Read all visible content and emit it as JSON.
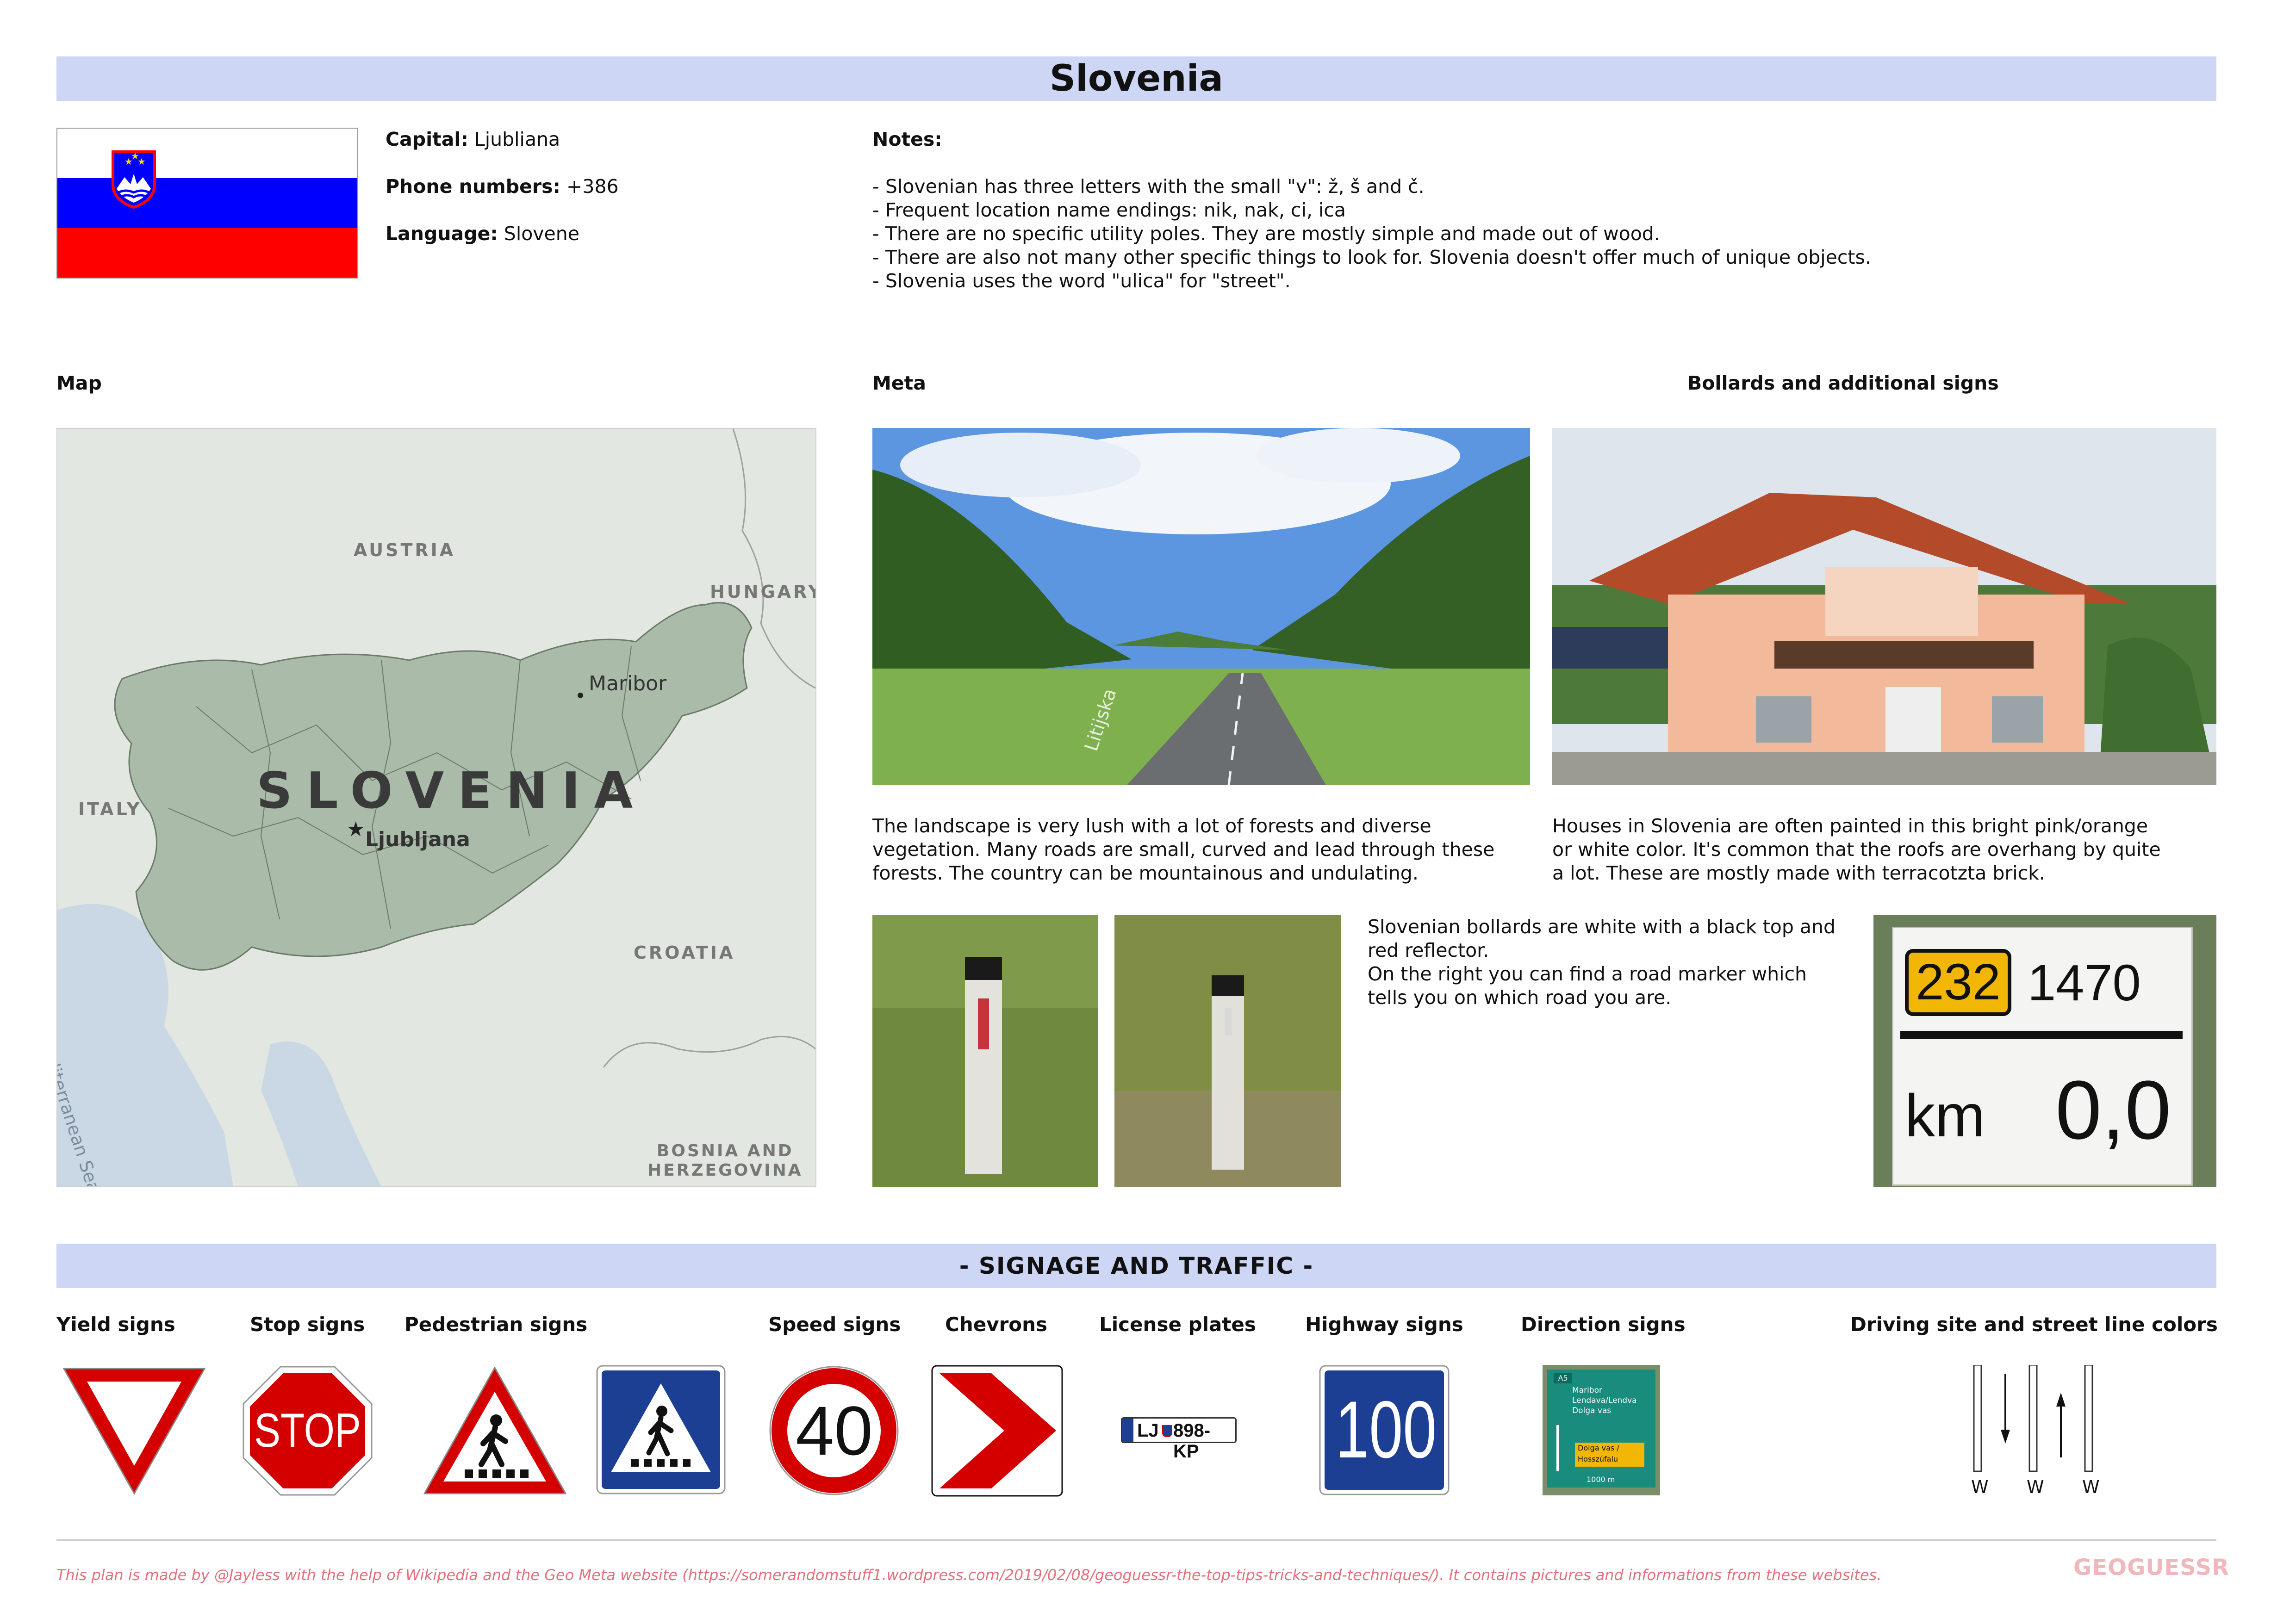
{
  "title": "Slovenia",
  "info": {
    "capital_label": "Capital:",
    "capital_value": "Ljubliana",
    "phone_label": "Phone numbers:",
    "phone_value": "+386",
    "language_label": "Language:",
    "language_value": "Slovene"
  },
  "notes": {
    "label": "Notes:",
    "lines": [
      "- Slovenian has three letters with the small \"v\": ž, š and č.",
      "- Frequent location name endings: nik, nak, ci, ica",
      "- There are no specific utility poles. They are mostly simple and made out of wood.",
      "- There are also not many other specific things to look for. Slovenia doesn't offer much of unique objects.",
      "- Slovenia uses the word \"ulica\" for \"street\"."
    ]
  },
  "sections": {
    "map": "Map",
    "meta": "Meta",
    "bollards": "Bollards and additional signs"
  },
  "map": {
    "country": "SLOVENIA",
    "capital": "Ljubljana",
    "city": "Maribor",
    "neighbors": [
      "AUSTRIA",
      "HUNGARY",
      "ITALY",
      "CROATIA",
      "BOSNIA AND",
      "HERZEGOVINA"
    ],
    "sea": "Mediterranean Sea"
  },
  "meta_text": [
    "The landscape is very lush with a lot of forests and diverse",
    "vegetation. Many roads are small, curved and lead through these",
    "forests. The country can be mountainous and undulating."
  ],
  "houses_text": [
    "Houses in Slovenia are often painted in this bright pink/orange",
    "or white color. It's common that the roofs are overhang by quite",
    "a lot. These are mostly made with terracotzta brick."
  ],
  "bollard_text": [
    "Slovenian bollards are white with a black top and",
    "red reflector.",
    "On the right you can find a road marker which",
    "tells you on which road you are."
  ],
  "road_marker": {
    "road": "232",
    "number": "1470",
    "km_label": "km",
    "km_value": "0,0"
  },
  "street_sign": "Litijska",
  "signage_banner": "- SIGNAGE AND TRAFFIC -",
  "sign_labels": {
    "yield": "Yield signs",
    "stop": "Stop signs",
    "pedestrian": "Pedestrian signs",
    "speed": "Speed signs",
    "chevrons": "Chevrons",
    "plates": "License plates",
    "highway": "Highway signs",
    "direction": "Direction signs",
    "driving": "Driving site and street line colors"
  },
  "signs": {
    "stop_text": "STOP",
    "speed_value": "40",
    "plate_prefix": "LJ",
    "plate_text": "898-KP",
    "highway_value": "100",
    "direction_lines": [
      "Maribor",
      "Lendava/Lendva",
      "Dolga vas"
    ],
    "direction_box": [
      "Dolga vas /",
      "Hosszúfalu"
    ],
    "direction_distance": "1000 m",
    "direction_road": "A5",
    "line_letters": [
      "W",
      "W",
      "W"
    ]
  },
  "footer": "This plan is made by @Jayless with the help of Wikipedia and the Geo Meta website (https://somerandomstuff1.wordpress.com/2019/02/08/geoguessr-the-top-tips-tricks-and-techniques/). It contains pictures and informations from these websites.",
  "logo": "GEOGUESSR",
  "colors": {
    "banner": "#cdd6f5",
    "flag_white": "#ffffff",
    "flag_blue": "#0000ff",
    "flag_red": "#ff0000",
    "sign_red": "#d40000",
    "sign_blue": "#1c3f94",
    "footer": "#e3707a"
  }
}
